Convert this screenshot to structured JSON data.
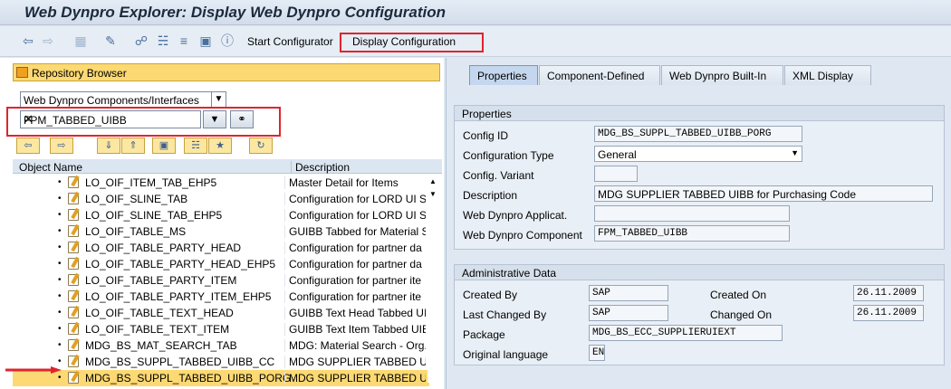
{
  "window": {
    "title": "Web Dynpro Explorer: Display Web Dynpro Configuration"
  },
  "toolbar": {
    "start_configurator": "Start Configurator",
    "display_configuration": "Display Configuration"
  },
  "repository": {
    "title": "Repository Browser",
    "object_type": "Web Dynpro Components/Interfaces",
    "search_value": "FPM_TABBED_UIBB",
    "columns": {
      "name": "Object Name",
      "description": "Description"
    },
    "rows": [
      {
        "name": "LO_OIF_ITEM_TAB_EHP5",
        "description": "Master Detail for Items"
      },
      {
        "name": "LO_OIF_SLINE_TAB",
        "description": "Configuration for LORD UI S"
      },
      {
        "name": "LO_OIF_SLINE_TAB_EHP5",
        "description": "Configuration for LORD UI S"
      },
      {
        "name": "LO_OIF_TABLE_MS",
        "description": "GUIBB Tabbed for Material S"
      },
      {
        "name": "LO_OIF_TABLE_PARTY_HEAD",
        "description": "Configuration for partner da"
      },
      {
        "name": "LO_OIF_TABLE_PARTY_HEAD_EHP5",
        "description": "Configuration for partner da"
      },
      {
        "name": "LO_OIF_TABLE_PARTY_ITEM",
        "description": "Configuration for partner ite"
      },
      {
        "name": "LO_OIF_TABLE_PARTY_ITEM_EHP5",
        "description": "Configuration for partner ite"
      },
      {
        "name": "LO_OIF_TABLE_TEXT_HEAD",
        "description": "GUIBB Text Head Tabbed UIB"
      },
      {
        "name": "LO_OIF_TABLE_TEXT_ITEM",
        "description": "GUIBB Text Item Tabbed UIBB"
      },
      {
        "name": "MDG_BS_MAT_SEARCH_TAB",
        "description": "MDG: Material Search - Org."
      },
      {
        "name": "MDG_BS_SUPPL_TABBED_UIBB_CC",
        "description": "MDG SUPPLIER TABBED UIE"
      },
      {
        "name": "MDG_BS_SUPPL_TABBED_UIBB_PORG",
        "description": "MDG SUPPLIER TABBED UIE"
      }
    ]
  },
  "tabs": [
    "Properties",
    "Component-Defined",
    "Web Dynpro Built-In",
    "XML Display"
  ],
  "properties": {
    "title": "Properties",
    "config_id_label": "Config ID",
    "config_id": "MDG_BS_SUPPL_TABBED_UIBB_PORG",
    "config_type_label": "Configuration Type",
    "config_type": "General",
    "variant_label": "Config. Variant",
    "variant": "",
    "description_label": "Description",
    "description": "MDG SUPPLIER TABBED UIBB for Purchasing Code",
    "application_label": "Web Dynpro Applicat.",
    "application": "",
    "component_label": "Web Dynpro Component",
    "component": "FPM_TABBED_UIBB"
  },
  "admin": {
    "title": "Administrative Data",
    "created_by_label": "Created By",
    "created_by": "SAP",
    "created_on_label": "Created On",
    "created_on": "26.11.2009",
    "changed_by_label": "Last Changed By",
    "changed_by": "SAP",
    "changed_on_label": "Changed On",
    "changed_on": "26.11.2009",
    "package_label": "Package",
    "package": "MDG_BS_ECC_SUPPLIERUIEXT",
    "language_label": "Original language",
    "language": "EN"
  }
}
